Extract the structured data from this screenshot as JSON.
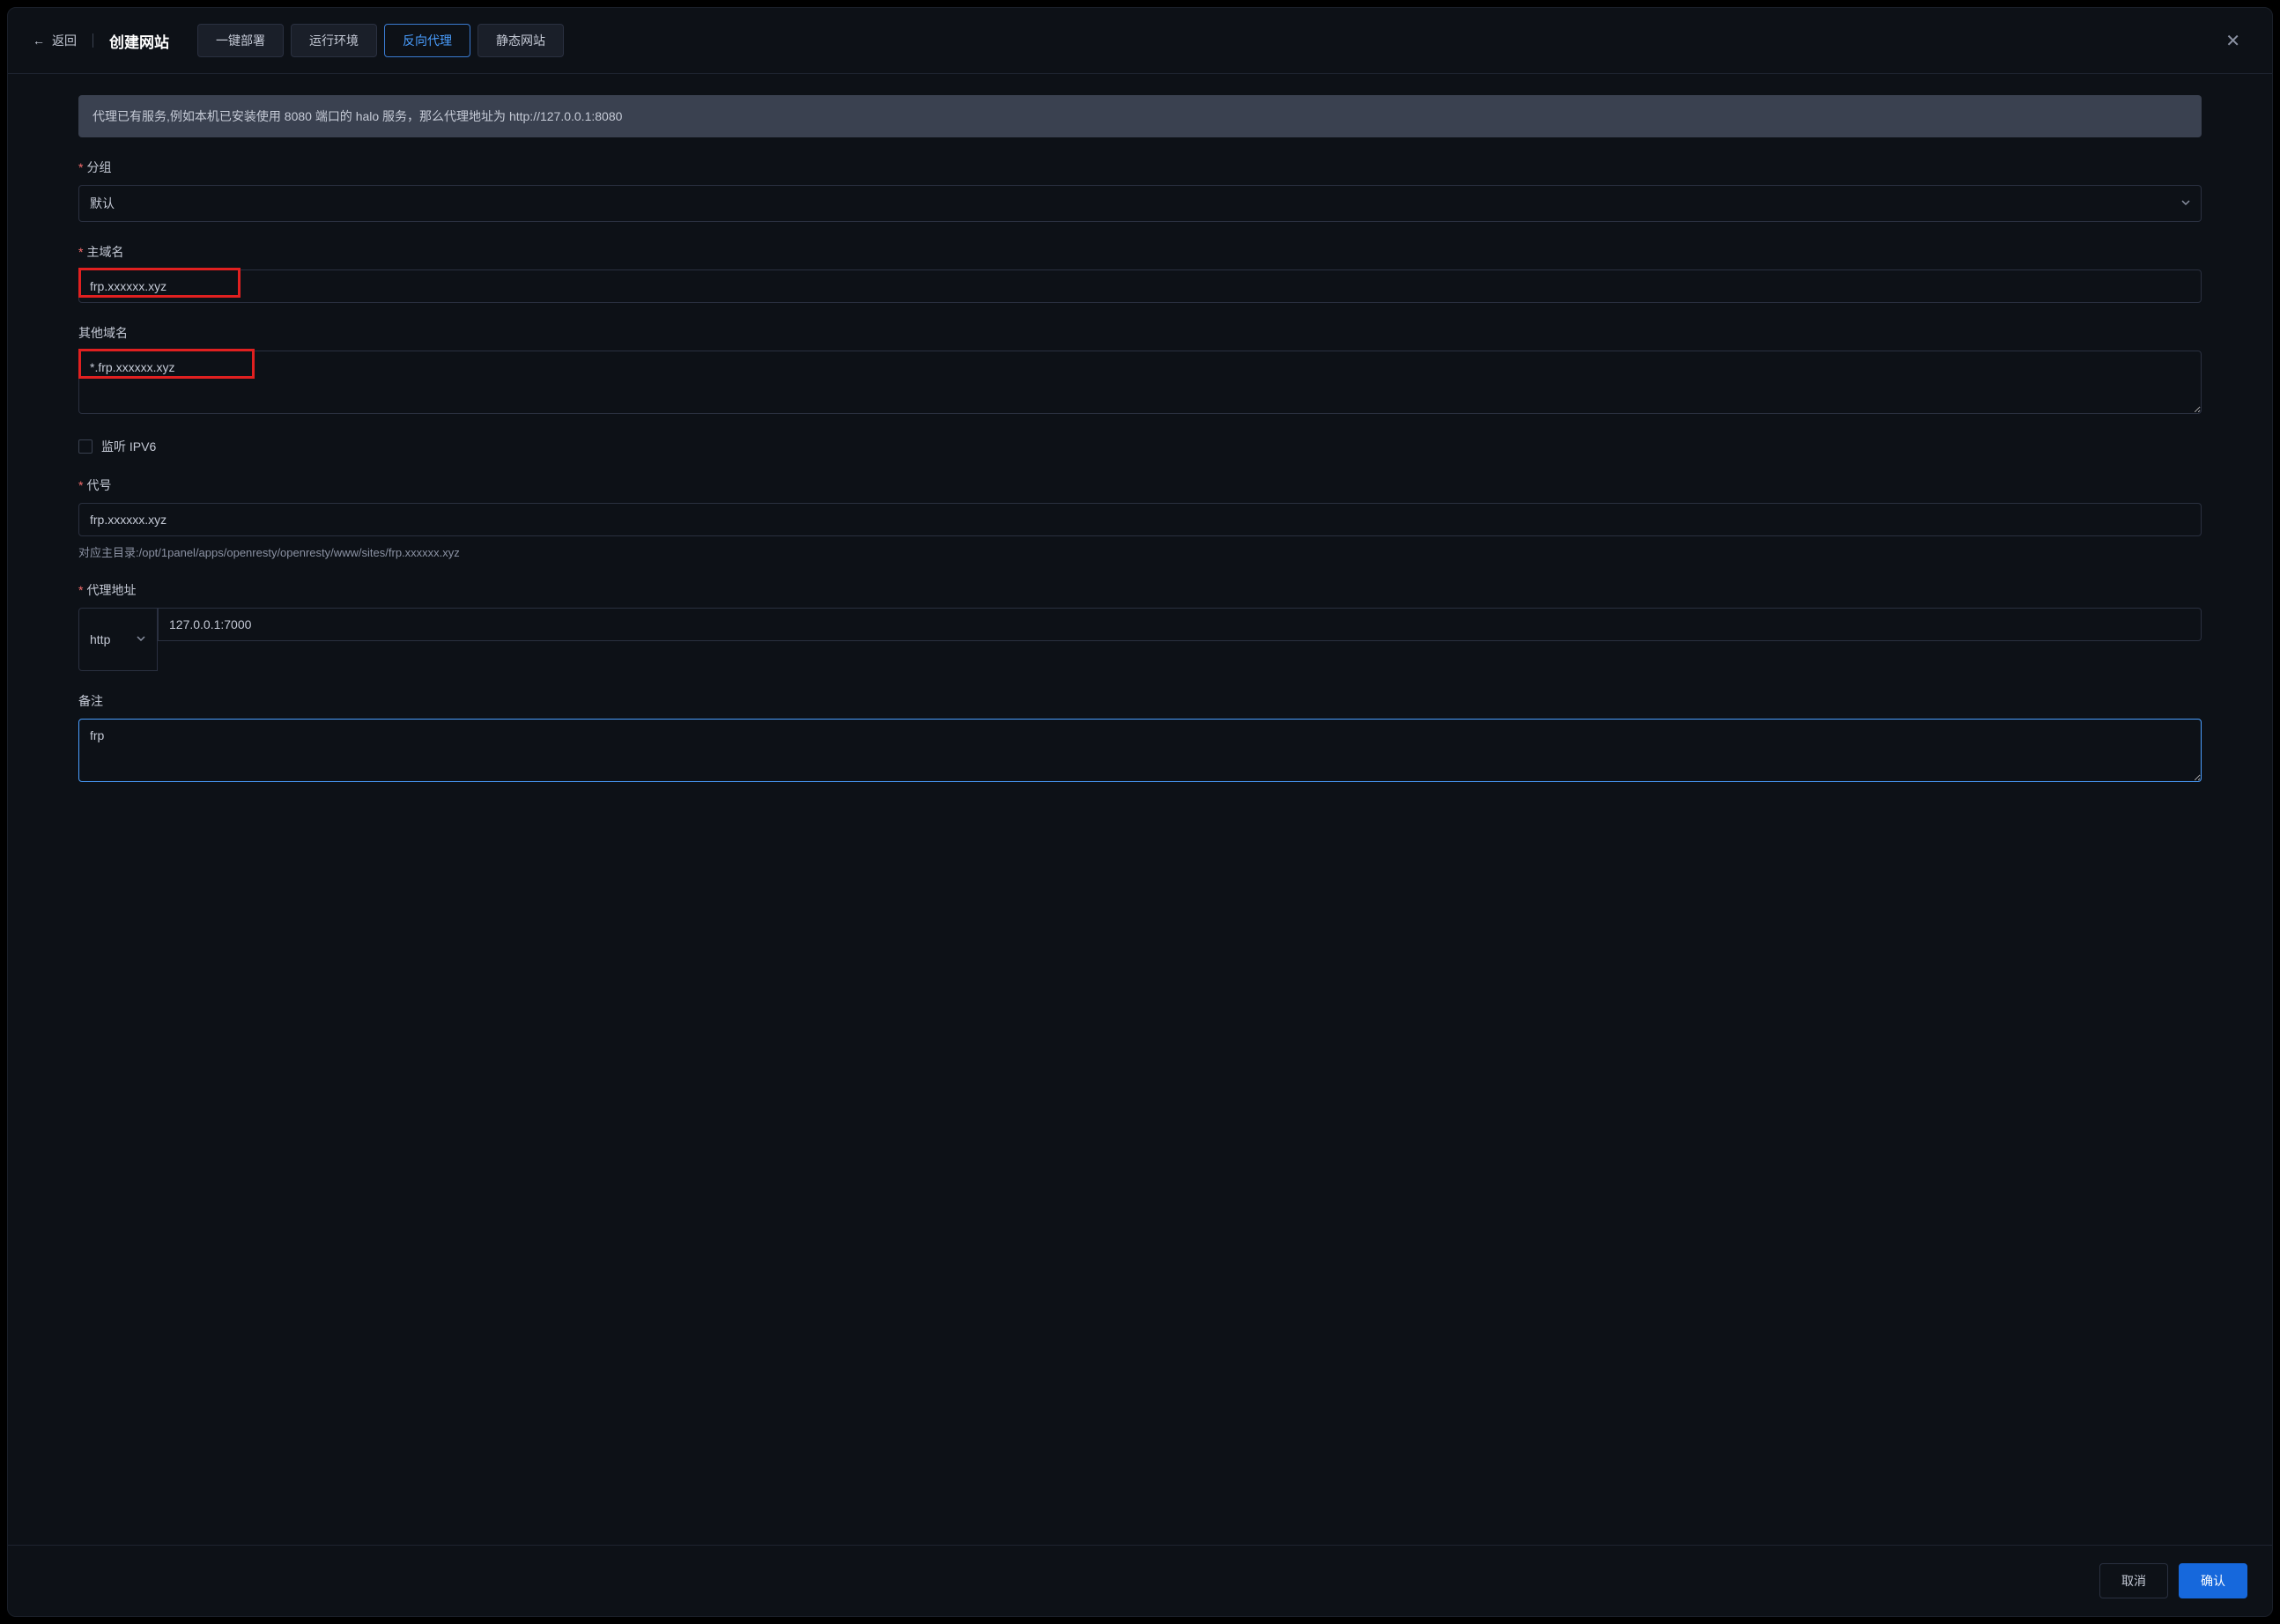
{
  "header": {
    "back_label": "返回",
    "title": "创建网站"
  },
  "tabs": {
    "one_click": "一键部署",
    "runtime": "运行环境",
    "reverse_proxy": "反向代理",
    "static": "静态网站"
  },
  "info_text": "代理已有服务,例如本机已安装使用 8080 端口的 halo 服务，那么代理地址为 http://127.0.0.1:8080",
  "form": {
    "group": {
      "label": "分组",
      "value": "默认"
    },
    "main_domain": {
      "label": "主域名",
      "value": "frp.xxxxxx.xyz"
    },
    "other_domains": {
      "label": "其他域名",
      "value": "*.frp.xxxxxx.xyz"
    },
    "ipv6": {
      "label": "监听 IPV6"
    },
    "alias": {
      "label": "代号",
      "value": "frp.xxxxxx.xyz",
      "helper": "对应主目录:/opt/1panel/apps/openresty/openresty/www/sites/frp.xxxxxx.xyz"
    },
    "proxy": {
      "label": "代理地址",
      "protocol": "http",
      "value": "127.0.0.1:7000"
    },
    "remark": {
      "label": "备注",
      "value": "frp"
    }
  },
  "footer": {
    "cancel": "取消",
    "confirm": "确认"
  }
}
